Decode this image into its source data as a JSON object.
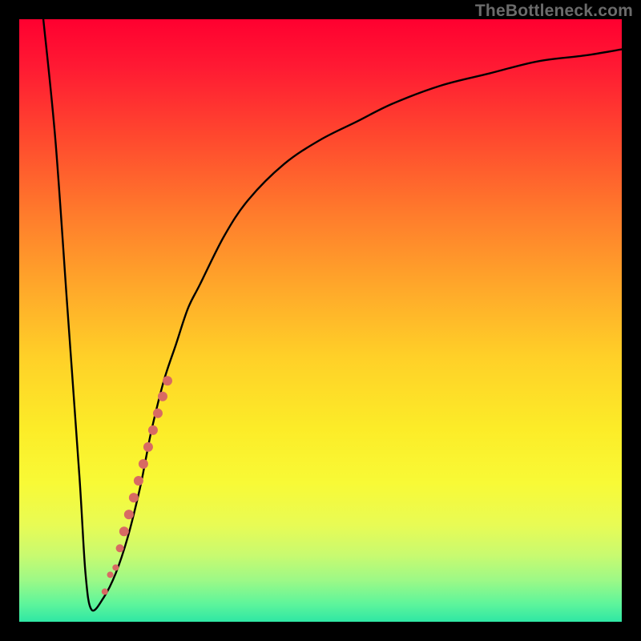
{
  "watermark": "TheBottleneck.com",
  "colors": {
    "curve": "#000000",
    "marker": "#d86a63",
    "background_black": "#000000"
  },
  "chart_data": {
    "type": "line",
    "title": "",
    "xlabel": "",
    "ylabel": "",
    "xlim": [
      0,
      100
    ],
    "ylim": [
      0,
      100
    ],
    "grid": false,
    "legend": false,
    "series": [
      {
        "name": "main-curve",
        "x": [
          4,
          6,
          8,
          10,
          11,
          12,
          14,
          16,
          18,
          20,
          21,
          22,
          24,
          26,
          28,
          30,
          34,
          38,
          44,
          50,
          56,
          62,
          70,
          78,
          86,
          94,
          100
        ],
        "y": [
          100,
          80,
          52,
          24,
          8,
          2,
          4,
          8,
          14,
          22,
          27,
          32,
          40,
          46,
          52,
          56,
          64,
          70,
          76,
          80,
          83,
          86,
          89,
          91,
          93,
          94,
          95
        ]
      }
    ],
    "markers": {
      "name": "highlight-segment",
      "color": "#d86a63",
      "points": [
        {
          "x": 14.2,
          "y": 5.0,
          "r": 4
        },
        {
          "x": 15.1,
          "y": 7.8,
          "r": 4
        },
        {
          "x": 16.0,
          "y": 9.0,
          "r": 4
        },
        {
          "x": 16.7,
          "y": 12.2,
          "r": 5
        },
        {
          "x": 17.4,
          "y": 15.0,
          "r": 6
        },
        {
          "x": 18.2,
          "y": 17.8,
          "r": 6
        },
        {
          "x": 19.0,
          "y": 20.6,
          "r": 6
        },
        {
          "x": 19.8,
          "y": 23.4,
          "r": 6
        },
        {
          "x": 20.6,
          "y": 26.2,
          "r": 6
        },
        {
          "x": 21.4,
          "y": 29.0,
          "r": 6
        },
        {
          "x": 22.2,
          "y": 31.8,
          "r": 6
        },
        {
          "x": 23.0,
          "y": 34.6,
          "r": 6
        },
        {
          "x": 23.8,
          "y": 37.4,
          "r": 6
        },
        {
          "x": 24.6,
          "y": 40.0,
          "r": 6
        }
      ]
    }
  }
}
